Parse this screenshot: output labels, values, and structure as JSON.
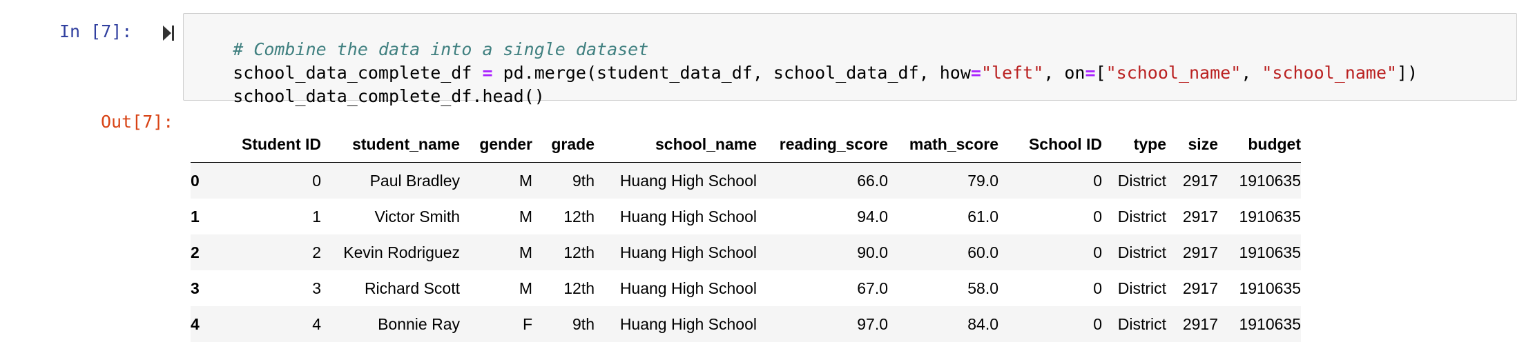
{
  "cell": {
    "in_prompt": "In [7]:",
    "out_prompt": "Out[7]:",
    "code": {
      "line1_comment": "# Combine the data into a single dataset",
      "line2": {
        "var": "school_data_complete_df ",
        "assign": "=",
        "call": " pd.merge(student_data_df, school_data_df, how",
        "eq1": "=",
        "str_left": "\"left\"",
        "mid": ", on",
        "eq2": "=",
        "bracket_open": "[",
        "str_school1": "\"school_name\"",
        "comma": ", ",
        "str_school2": "\"school_name\"",
        "bracket_close": "])"
      },
      "line3": "school_data_complete_df.head()"
    }
  },
  "icons": {
    "run": "step-forward-icon"
  },
  "table": {
    "columns": [
      "",
      "Student ID",
      "student_name",
      "gender",
      "grade",
      "school_name",
      "reading_score",
      "math_score",
      "School ID",
      "type",
      "size",
      "budget"
    ],
    "rows": [
      {
        "index": "0",
        "cells": [
          "0",
          "Paul Bradley",
          "M",
          "9th",
          "Huang High School",
          "66.0",
          "79.0",
          "0",
          "District",
          "2917",
          "1910635"
        ]
      },
      {
        "index": "1",
        "cells": [
          "1",
          "Victor Smith",
          "M",
          "12th",
          "Huang High School",
          "94.0",
          "61.0",
          "0",
          "District",
          "2917",
          "1910635"
        ]
      },
      {
        "index": "2",
        "cells": [
          "2",
          "Kevin Rodriguez",
          "M",
          "12th",
          "Huang High School",
          "90.0",
          "60.0",
          "0",
          "District",
          "2917",
          "1910635"
        ]
      },
      {
        "index": "3",
        "cells": [
          "3",
          "Richard Scott",
          "M",
          "12th",
          "Huang High School",
          "67.0",
          "58.0",
          "0",
          "District",
          "2917",
          "1910635"
        ]
      },
      {
        "index": "4",
        "cells": [
          "4",
          "Bonnie Ray",
          "F",
          "9th",
          "Huang High School",
          "97.0",
          "84.0",
          "0",
          "District",
          "2917",
          "1910635"
        ]
      }
    ]
  },
  "colors": {
    "in_prompt": "#303f9f",
    "out_prompt": "#d84315",
    "comment": "#408080",
    "operator": "#aa22ff",
    "string": "#ba2121",
    "code_bg": "#f7f7f7"
  }
}
